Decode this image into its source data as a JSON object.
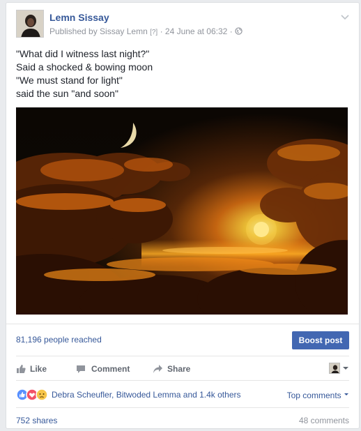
{
  "post": {
    "author": "Lemn Sissay",
    "published_by": "Published by Sissay Lemn",
    "help_marker": "[?]",
    "separator": "·",
    "timestamp": "24 June at 06:32",
    "privacy_icon": "globe-icon",
    "menu_icon": "chevron-down-icon",
    "text_lines": [
      "\"What did I witness last night?\"",
      "Said a shocked & bowing moon",
      "\"We must stand for light\"",
      "said the sun \"and soon\""
    ]
  },
  "insights": {
    "reached": "81,196 people reached",
    "boost_label": "Boost post",
    "boost_color": "#4267b2"
  },
  "actions": {
    "like": "Like",
    "comment": "Comment",
    "share": "Share"
  },
  "reactions": {
    "icons": [
      "like-icon",
      "love-icon",
      "sad-icon"
    ],
    "names": "Debra Scheufler, Bitwoded Lemma and 1.4k others",
    "sort_label": "Top comments"
  },
  "footer": {
    "shares": "752 shares",
    "comments": "48 comments"
  },
  "colors": {
    "link": "#365899",
    "muted": "#90949c",
    "action": "#616770"
  }
}
